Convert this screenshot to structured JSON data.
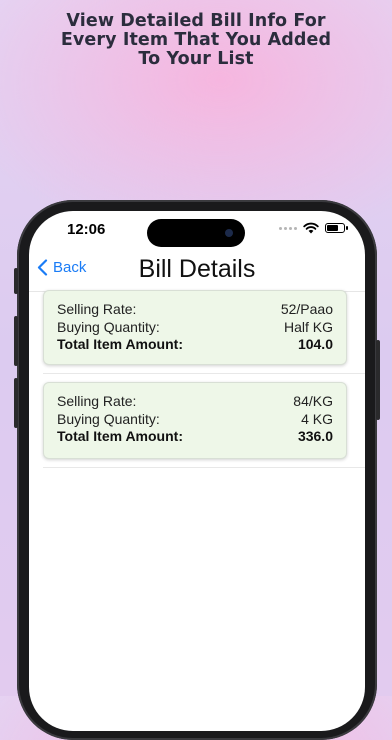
{
  "headline": {
    "line1": "View Detailed Bill Info For",
    "line2": "Every Item That You Added",
    "line3": "To Your List"
  },
  "status_bar": {
    "time": "12:06"
  },
  "nav": {
    "back_label": "Back",
    "title": "Bill Details"
  },
  "labels": {
    "selling_rate": "Selling Rate:",
    "buying_quantity": "Buying Quantity:",
    "total_item_amount": "Total Item Amount:"
  },
  "items": [
    {
      "selling_rate": "52/Paao",
      "buying_quantity": "Half KG",
      "total_item_amount": "104.0"
    },
    {
      "selling_rate": "84/KG",
      "buying_quantity": "4 KG",
      "total_item_amount": "336.0"
    }
  ],
  "colors": {
    "accent": "#1a7cf6",
    "card_bg": "#eef7e8"
  }
}
